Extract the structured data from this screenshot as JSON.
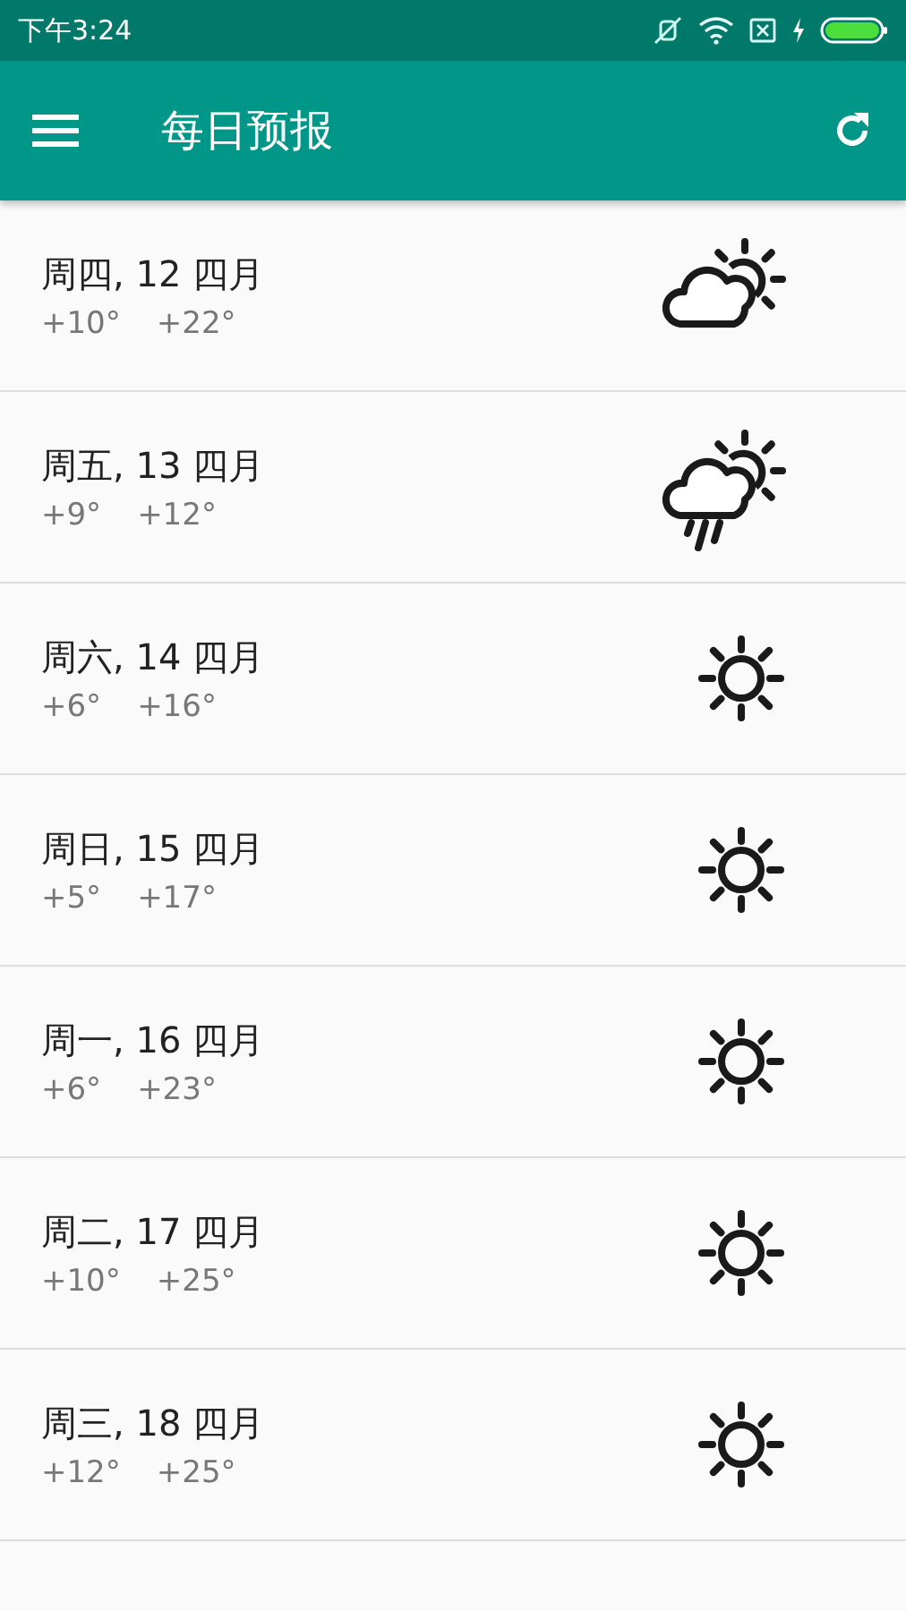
{
  "status_bar": {
    "time": "下午3:24"
  },
  "toolbar": {
    "title": "每日预报"
  },
  "days": [
    {
      "date": "周四, 12 四月",
      "low": "+10°",
      "high": "+22°",
      "kind": "partly-cloudy"
    },
    {
      "date": "周五, 13 四月",
      "low": "+9°",
      "high": "+12°",
      "kind": "rain"
    },
    {
      "date": "周六, 14 四月",
      "low": "+6°",
      "high": "+16°",
      "kind": "sunny"
    },
    {
      "date": "周日, 15 四月",
      "low": "+5°",
      "high": "+17°",
      "kind": "sunny"
    },
    {
      "date": "周一, 16 四月",
      "low": "+6°",
      "high": "+23°",
      "kind": "sunny"
    },
    {
      "date": "周二, 17 四月",
      "low": "+10°",
      "high": "+25°",
      "kind": "sunny"
    },
    {
      "date": "周三, 18 四月",
      "low": "+12°",
      "high": "+25°",
      "kind": "sunny"
    }
  ]
}
